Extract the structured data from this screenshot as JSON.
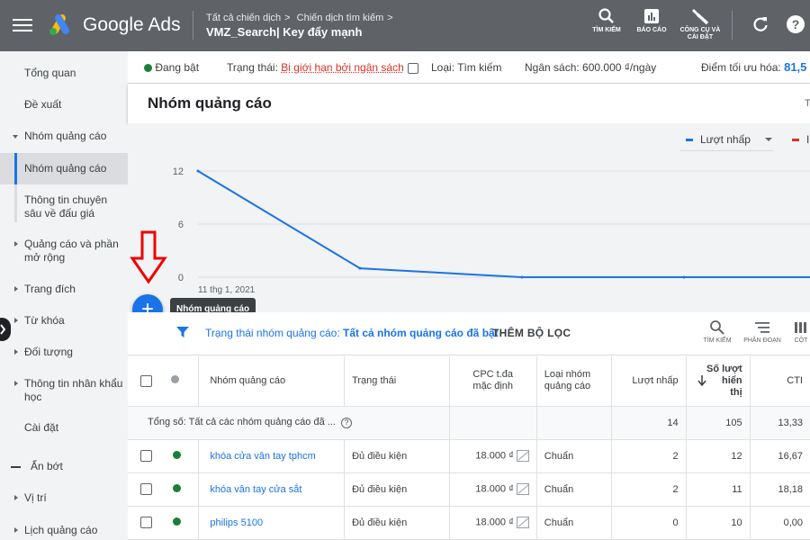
{
  "header": {
    "brand": "Google Ads",
    "breadcrumbs": [
      "Tất cả chiến dịch",
      "Chiến dịch tìm kiếm"
    ],
    "campaign": "VMZ_Search| Key đẩy mạnh",
    "tools": [
      {
        "label": "TÌM KIẾM",
        "icon": "search-icon"
      },
      {
        "label": "BÁO CÁO",
        "icon": "report-icon"
      },
      {
        "label_line1": "CÔNG CỤ VÀ",
        "label_line2": "CÀI ĐẶT",
        "icon": "wrench-icon"
      }
    ]
  },
  "sidebar": {
    "items": [
      {
        "label": "Tổng quan"
      },
      {
        "label": "Đề xuất"
      },
      {
        "label": "Nhóm quảng cáo"
      },
      {
        "label": "Nhóm quảng cáo"
      },
      {
        "label": "Thông tin chuyên sâu về đấu giá"
      },
      {
        "label": "Quảng cáo và phần mở rộng"
      },
      {
        "label": "Trang đích"
      },
      {
        "label": "Từ khóa"
      },
      {
        "label": "Đối tượng"
      },
      {
        "label": "Thông tin nhân khẩu học"
      },
      {
        "label": "Cài đặt"
      },
      {
        "label": "Ẩn bớt"
      },
      {
        "label": "Vị trí"
      },
      {
        "label": "Lịch quảng cáo"
      }
    ]
  },
  "status": {
    "state": "Đang bật",
    "status_label": "Trạng thái:",
    "status_value": "Bị giới hạn bởi ngân sách",
    "type": "Loại: Tìm kiếm",
    "budget": "Ngân sách: 600.000 ₫/ngày",
    "opt_label": "Điểm tối ưu hóa:",
    "opt_value": "81,5"
  },
  "page_title": "Nhóm quảng cáo",
  "page_title_right": "T",
  "chart": {
    "legend_primary": "Lượt nhấp",
    "legend_secondary": "I",
    "primary_color": "#1a73e8",
    "secondary_color": "#d93025"
  },
  "chart_data": {
    "type": "line",
    "x": [
      "11 thg 1, 2021",
      "",
      "",
      "",
      ""
    ],
    "series": [
      {
        "name": "Lượt nhấp",
        "values": [
          12,
          1,
          0,
          0,
          0
        ]
      }
    ],
    "ylim": [
      0,
      12
    ],
    "yticks": [
      "12",
      "6",
      "0"
    ],
    "xtick_label": "11 thg 1, 2021",
    "grid": true
  },
  "fab": {
    "symbol": "+",
    "tooltip": "Nhóm quảng cáo"
  },
  "filter": {
    "prefix": "Trạng thái nhóm quảng cáo:",
    "value": "Tất cả nhóm quảng cáo đã bật",
    "add": "THÊM BỘ LỌC",
    "tools": [
      "TÌM KIẾM",
      "PHÂN ĐOẠN",
      "CỘT"
    ]
  },
  "table": {
    "headers": {
      "name": "Nhóm quảng cáo",
      "status": "Trạng thái",
      "cpc_l1": "CPC t.đa",
      "cpc_l2": "mặc định",
      "type_l1": "Loại nhóm",
      "type_l2": "quảng cáo",
      "clicks": "Lượt nhấp",
      "impr_l1": "Số lượt",
      "impr_l2": "hiển",
      "impr_l3": "thị",
      "ctr": "CTI"
    },
    "total": {
      "label": "Tổng số: Tất cả các nhóm quảng cáo đã ...",
      "clicks": "14",
      "impr": "105",
      "ctr": "13,33"
    },
    "rows": [
      {
        "name": "khóa cửa vân tay tphcm",
        "status": "Đủ điều kiện",
        "cpc": "18.000 ₫",
        "type": "Chuẩn",
        "clicks": "2",
        "impr": "12",
        "ctr": "16,67"
      },
      {
        "name": "khóa vân tay cửa sắt",
        "status": "Đủ điều kiện",
        "cpc": "18.000 ₫",
        "type": "Chuẩn",
        "clicks": "2",
        "impr": "11",
        "ctr": "18,18"
      },
      {
        "name": "philips 5100",
        "status": "Đủ điều kiện",
        "cpc": "18.000 ₫",
        "type": "Chuẩn",
        "clicks": "0",
        "impr": "10",
        "ctr": "0,00"
      }
    ]
  }
}
